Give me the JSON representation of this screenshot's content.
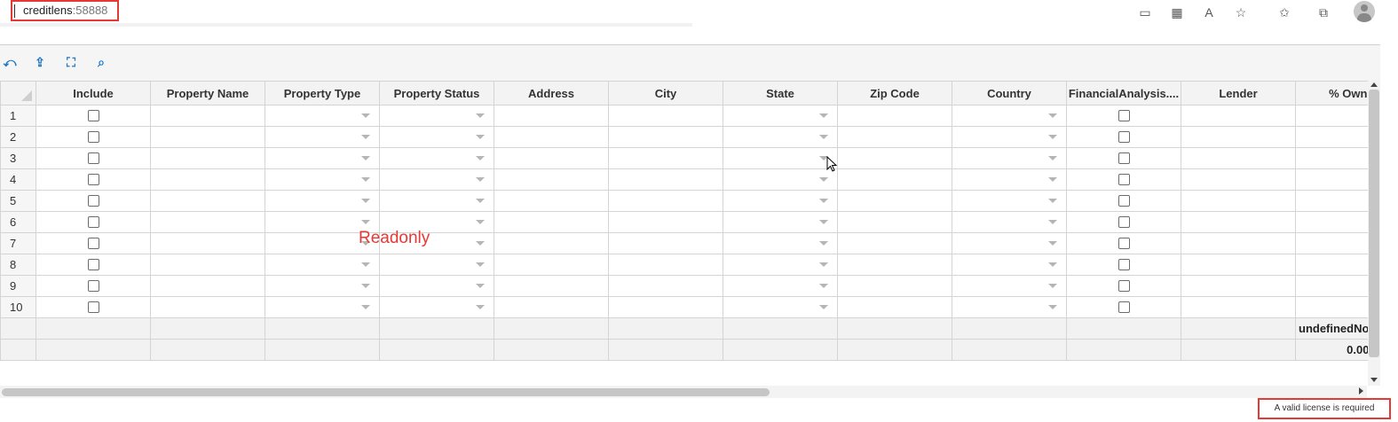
{
  "browser": {
    "address_host": "creditlens",
    "address_port": ":58888",
    "icons": [
      "device-icon",
      "apps-icon",
      "read-aloud-icon",
      "add-favorite-icon",
      "favorites-icon",
      "collections-icon",
      "profile-icon"
    ]
  },
  "toolbar": {
    "icons": [
      "undo-icon",
      "export-icon",
      "fullscreen-icon",
      "search-icon"
    ]
  },
  "grid": {
    "columns": [
      "Include",
      "Property Name",
      "Property Type",
      "Property Status",
      "Address",
      "City",
      "State",
      "Zip Code",
      "Country",
      "FinancialAnalysis....",
      "Lender",
      "% Own"
    ],
    "row_numbers": [
      "1",
      "2",
      "3",
      "4",
      "5",
      "6",
      "7",
      "8",
      "9",
      "10"
    ],
    "footer1_last": "undefinedNo",
    "footer2_last": "0.00"
  },
  "annotation": {
    "readonly": "Readonly"
  },
  "license": {
    "text": "A valid license is required"
  },
  "colors": {
    "accent": "#1f77c4",
    "annotation": "#e53935"
  }
}
